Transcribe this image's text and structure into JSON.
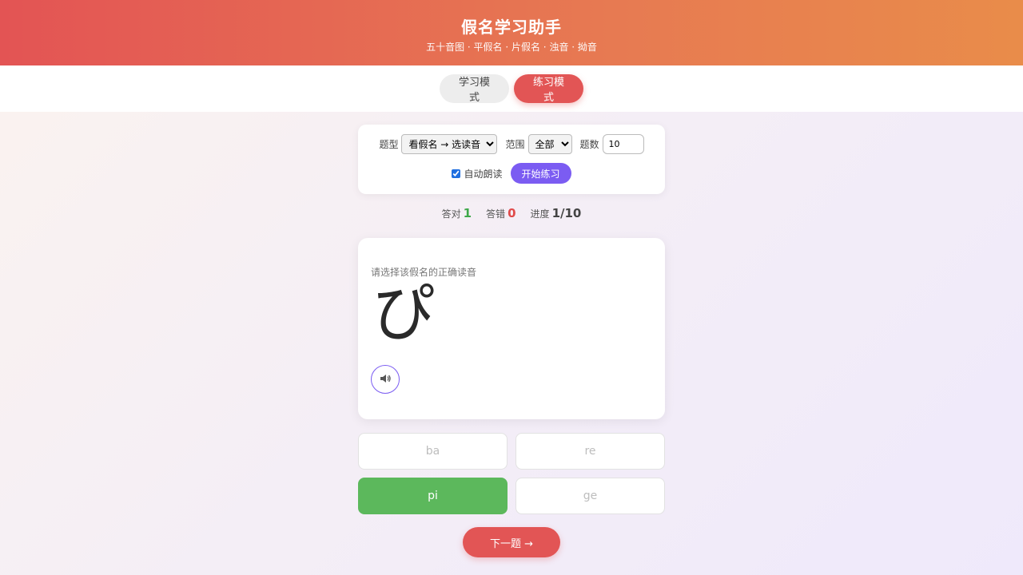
{
  "header": {
    "title": "假名学习助手",
    "subtitle": "五十音图 · 平假名 · 片假名 · 浊音 · 拗音"
  },
  "modes": {
    "learn_label": "学习模式",
    "practice_label": "练习模式",
    "active": "practice"
  },
  "settings": {
    "type_label": "题型",
    "type_value": "看假名 → 选读音",
    "range_label": "范围",
    "range_value": "全部",
    "count_label": "题数",
    "count_value": "10",
    "auto_read_label": "自动朗读",
    "auto_read_checked": true,
    "start_label": "开始练习"
  },
  "stats": {
    "correct_label": "答对",
    "correct_value": "1",
    "wrong_label": "答错",
    "wrong_value": "0",
    "progress_label": "进度",
    "progress_value": "1/10"
  },
  "question": {
    "prompt": "请选择该假名的正确读音",
    "kana": "ぴ",
    "speaker_icon": "speaker-icon"
  },
  "options": [
    {
      "label": "ba",
      "state": "normal"
    },
    {
      "label": "re",
      "state": "normal"
    },
    {
      "label": "pi",
      "state": "correct"
    },
    {
      "label": "ge",
      "state": "normal"
    }
  ],
  "next_label": "下一题 →",
  "colors": {
    "accent_red": "#e25555",
    "accent_purple": "#7b5cf2",
    "correct_green": "#5cb85c",
    "header_start": "#e35454",
    "header_end": "#e98c4a"
  }
}
